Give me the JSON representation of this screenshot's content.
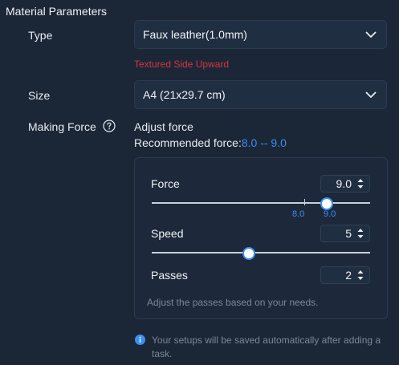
{
  "section": {
    "title": "Material Parameters"
  },
  "type_row": {
    "label": "Type",
    "value": "Faux leather(1.0mm)",
    "warning": "Textured Side Upward"
  },
  "size_row": {
    "label": "Size",
    "value": "A4 (21x29.7 cm)"
  },
  "force_row": {
    "label": "Making Force",
    "adjust": "Adjust force",
    "recommended_prefix": "Recommended force:",
    "recommended_range": "8.0 -- 9.0"
  },
  "params": {
    "force": {
      "label": "Force",
      "value": "9.0",
      "level_fraction": 0.9,
      "marker_low": "8.0",
      "marker_high": "9.0"
    },
    "speed": {
      "label": "Speed",
      "value": "5",
      "level_fraction": 0.5
    },
    "passes": {
      "label": "Passes",
      "value": "2"
    },
    "hint": "Adjust the passes based on your needs."
  },
  "info": {
    "text": "Your setups will be saved automatically after adding a task."
  },
  "colors": {
    "background": "#1b2637",
    "accent": "#3b8ff0",
    "warning": "#d8353d"
  },
  "icons": {
    "dropdown": "chevron-down-icon",
    "help": "question-circle-icon",
    "spinner": "spin-arrows-icon",
    "info": "info-circle-icon"
  }
}
